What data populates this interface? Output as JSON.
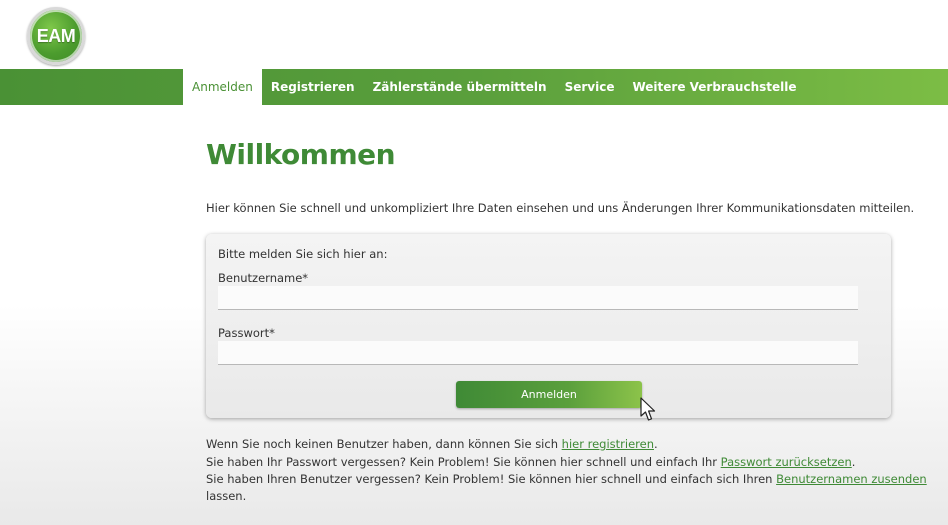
{
  "brand": {
    "logo_text": "EAM",
    "logo_color": "#4c9c2e"
  },
  "nav": {
    "items": [
      {
        "label": "Anmelden",
        "active": true
      },
      {
        "label": "Registrieren",
        "active": false
      },
      {
        "label": "Zählerstände übermitteln",
        "active": false
      },
      {
        "label": "Service",
        "active": false
      },
      {
        "label": "Weitere Verbrauchstelle",
        "active": false
      }
    ]
  },
  "main": {
    "title": "Willkommen",
    "intro": "Hier können Sie schnell und unkompliziert Ihre Daten einsehen und uns Änderungen Ihrer Kommunikationsdaten mitteilen."
  },
  "login": {
    "prompt": "Bitte melden Sie sich hier an:",
    "username_label": "Benutzername*",
    "username_value": "",
    "password_label": "Passwort*",
    "password_value": "",
    "submit_label": "Anmelden"
  },
  "help": {
    "register_text": "Wenn Sie noch keinen Benutzer haben, dann können Sie sich",
    "register_link": "hier registrieren",
    "register_end": ".",
    "password_text": "Sie haben Ihr Passwort vergessen? Kein Problem! Sie können hier schnell und einfach Ihr",
    "password_link": "Passwort zurücksetzen",
    "password_end": ".",
    "username_text": "Sie haben Ihren Benutzer vergessen? Kein Problem! Sie können hier schnell und einfach sich Ihren",
    "username_link": "Benutzernamen zusenden",
    "username_end": "lassen."
  },
  "colors": {
    "accent": "#3f8a36",
    "nav_light": "#7cbd45"
  }
}
